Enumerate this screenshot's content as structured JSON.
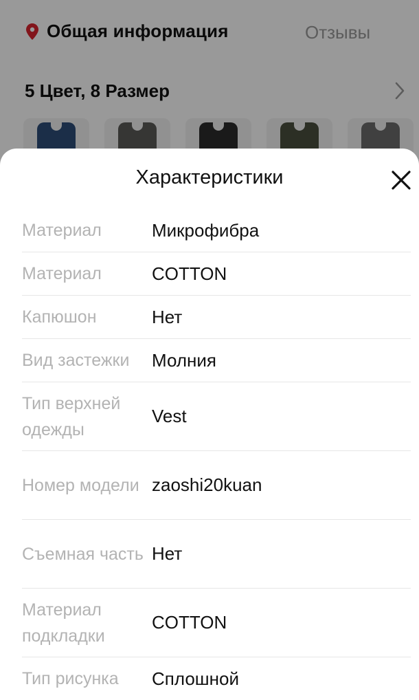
{
  "background": {
    "tab_general": "Общая информация",
    "tab_reviews": "Отзывы",
    "variants_label": "5 Цвет, 8 Размер",
    "thumbnails": [
      {
        "color": "#2d4e78"
      },
      {
        "color": "#5a5a58"
      },
      {
        "color": "#2c2c2c"
      },
      {
        "color": "#4a4f3e"
      },
      {
        "color": "#6b6b6b"
      }
    ]
  },
  "sheet": {
    "title": "Характеристики",
    "specs": [
      {
        "label": "Материал",
        "value": "Микрофибра"
      },
      {
        "label": "Материал",
        "value": "COTTON"
      },
      {
        "label": "Капюшон",
        "value": "Нет"
      },
      {
        "label": "Вид застежки",
        "value": "Молния"
      },
      {
        "label": "Тип верхней одежды",
        "value": "Vest"
      },
      {
        "label": "Номер модели",
        "value": "zaoshi20kuan"
      },
      {
        "label": "Съемная часть",
        "value": "Нет"
      },
      {
        "label": "Материал подкладки",
        "value": "COTTON"
      },
      {
        "label": "Тип рисунка",
        "value": "Сплошной"
      }
    ]
  },
  "colors": {
    "accent_pin": "#d9232e",
    "label_gray": "#b3b3b3",
    "tab_inactive": "#9a9a9a"
  }
}
